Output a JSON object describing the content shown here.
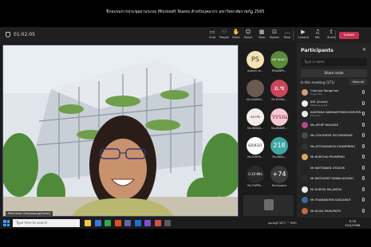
{
  "window": {
    "title": "ฝึกอบรมการประชุมผ่านระบบ Microsoft Teams สำหรับบุคลากร มหาวิทยาลัยราชภัฏ 2565"
  },
  "meeting": {
    "timer": "01:02:05",
    "toolbar": [
      {
        "label": "Chat",
        "icon": "chat-icon",
        "glyph": "▭"
      },
      {
        "label": "People",
        "icon": "people-icon",
        "glyph": "⚇",
        "active": true
      },
      {
        "label": "Raise",
        "icon": "raise-hand-icon",
        "glyph": "✋"
      },
      {
        "label": "React",
        "icon": "react-icon",
        "glyph": "☺"
      },
      {
        "label": "View",
        "icon": "view-icon",
        "glyph": "▦"
      },
      {
        "label": "Rooms",
        "icon": "rooms-icon",
        "glyph": "⊡"
      },
      {
        "label": "More",
        "icon": "more-icon",
        "glyph": "…"
      },
      {
        "label": "Camera",
        "icon": "camera-icon",
        "glyph": "▶"
      },
      {
        "label": "Mic",
        "icon": "mic-icon",
        "glyph": "♫"
      },
      {
        "label": "Share",
        "icon": "share-icon",
        "glyph": "⇧"
      }
    ],
    "leave_label": "Leave"
  },
  "main_video": {
    "name": "Patcharee Chaiyawong(Guest)"
  },
  "thumbnails": [
    {
      "initials": "PS",
      "name": "protech se...",
      "bg": "#f2e3b5",
      "fg": "#333"
    },
    {
      "initials": "ตลาดมหา",
      "name": "MSVANPH...",
      "bg": "#5a8a3a",
      "fg": "#fff"
    },
    {
      "initials": "",
      "name": "Ms.SAAKNO...",
      "bg": "#6a5a50",
      "fg": "#fff"
    },
    {
      "initials": "อ.ซ",
      "name": "Ms.KOSAK...",
      "bg": "#c8455a",
      "fg": "#fff"
    },
    {
      "initials": "ฉัตรชัย",
      "name": "Ms.YANISA...",
      "bg": "#f3efe8",
      "fg": "#5a3a8a"
    },
    {
      "initials": "วรรณ",
      "name": "Ms.MANEE...",
      "bg": "#f4c9d4",
      "fg": "#8a2a4a"
    },
    {
      "initials": "8209321",
      "name": "Ms.SURIYA...",
      "bg": "#ffffff",
      "fg": "#222"
    },
    {
      "initials": "218",
      "name": "Ms.JINDA...",
      "bg": "#3ea7a3",
      "fg": "#fff"
    },
    {
      "initials": "0.10 ยี่สิบ",
      "name": "Ms.THIPPA...",
      "bg": "#2a2a2a",
      "fg": "#fff"
    },
    {
      "initials": "+74",
      "name": "Participants",
      "bg": "#3a3a3a",
      "fg": "#fff"
    }
  ],
  "panel": {
    "title": "Participants",
    "search_placeholder": "Type a name",
    "share_label": "Share invite",
    "in_meeting": "In this meeting (171)",
    "mute_all": "Mute all",
    "people": [
      {
        "name": "Chaniya Sangchan",
        "sub": "Organizer",
        "color": "#c9a27a"
      },
      {
        "name": "JDS (Guest)",
        "sub": "Meeting guest",
        "color": "#f0f0f0"
      },
      {
        "name": "KANTANA WANNAPONGCHAROEN",
        "sub": "External",
        "color": "#e8e8e8"
      },
      {
        "name": "Ms.ATHIP WAGASE",
        "sub": "",
        "color": "#b04a8a"
      },
      {
        "name": "Ms.CHAIYAPAT BOONYARAM",
        "sub": "",
        "color": "#4a4a4a"
      },
      {
        "name": "Ms.JETSADAMON KHAMPRING",
        "sub": "",
        "color": "#333333"
      },
      {
        "name": "Mr.KORCHAI PEANPING",
        "sub": "",
        "color": "#d8a860"
      },
      {
        "name": "Mr.NATTAWAN UTAGUK",
        "sub": "",
        "color": "#222222"
      },
      {
        "name": "Mr.NATHAPAT SAWALAGAMO",
        "sub": "",
        "color": "#2b2b2b"
      },
      {
        "name": "Mr.SURIYA PALAMON",
        "sub": "",
        "color": "#e8e8e8"
      },
      {
        "name": "Mr.THANAKORN SAIGAMUT",
        "sub": "",
        "color": "#3a6a9a"
      },
      {
        "name": "Mr.ALISA PAISUPATH",
        "sub": "",
        "color": "#c06a3a"
      }
    ]
  },
  "taskbar": {
    "search_placeholder": "Type here to search",
    "apps": [
      "#f2c744",
      "#3a7bd5",
      "#2eaa4a",
      "#e34c26",
      "#6264a7",
      "#1f6fd1",
      "#7b4fd1",
      "#d14f4f",
      "#5a5a5a"
    ],
    "tray_text": "อุณหภูมิ 34°C  ⌃  ENG",
    "time": "9:18",
    "date": "15/2/2566"
  }
}
